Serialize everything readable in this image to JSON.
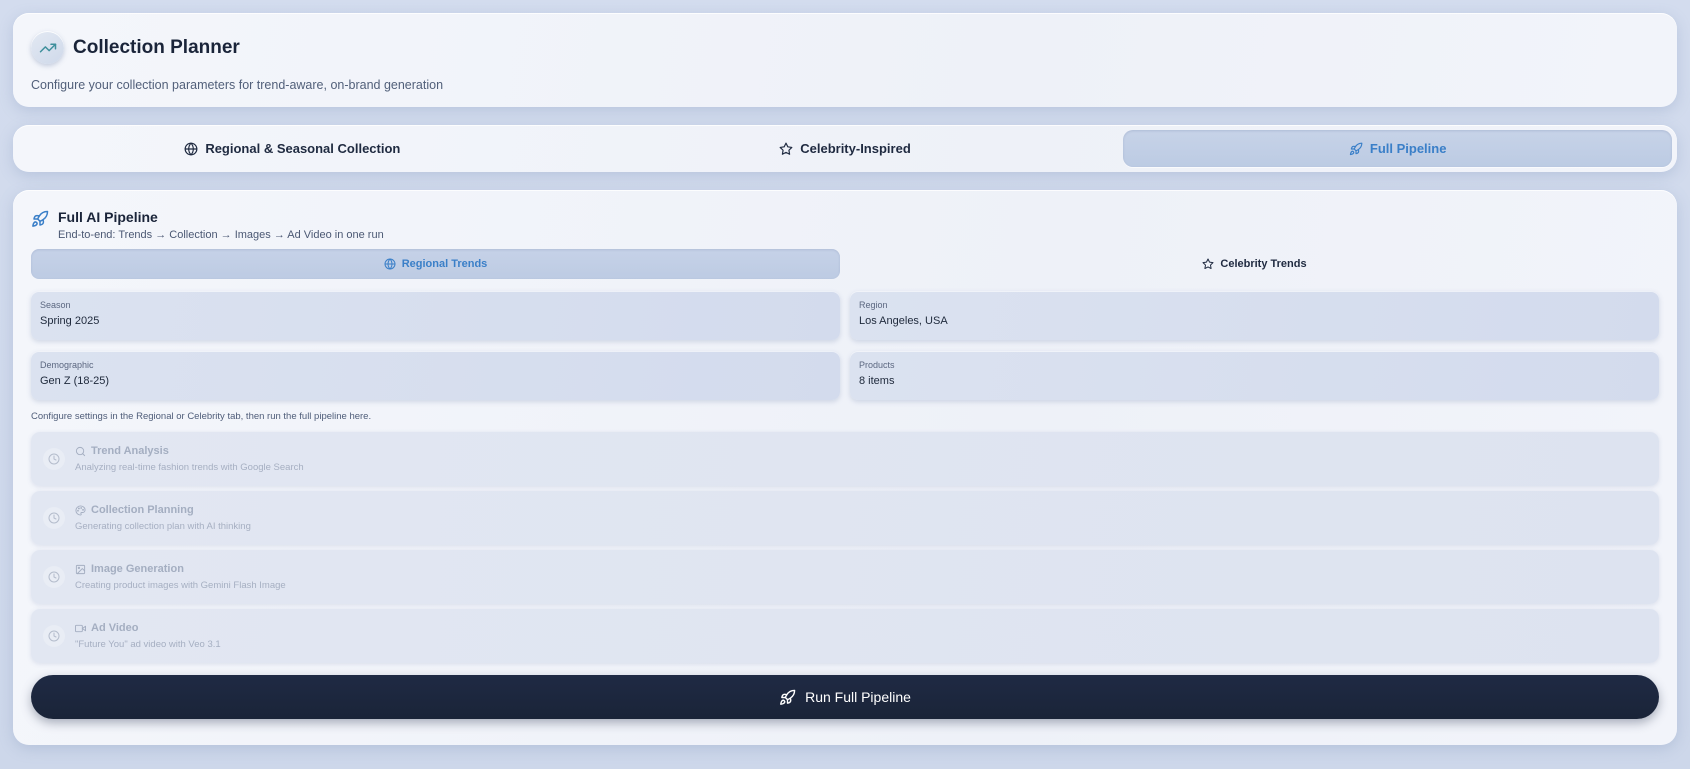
{
  "header": {
    "title": "Collection Planner",
    "subtitle": "Configure your collection parameters for trend-aware, on-brand generation",
    "icon": "trending-up-icon"
  },
  "mode_tabs": [
    {
      "label": "Regional & Seasonal Collection",
      "icon": "globe-icon",
      "active": false
    },
    {
      "label": "Celebrity-Inspired",
      "icon": "star-icon",
      "active": false
    },
    {
      "label": "Full Pipeline",
      "icon": "rocket-icon",
      "active": true
    }
  ],
  "pipeline": {
    "title": "Full AI Pipeline",
    "description": "End-to-end: Trends → Collection → Images → Ad Video in one run",
    "icon": "rocket-icon",
    "source_tabs": [
      {
        "label": "Regional Trends",
        "icon": "globe-icon",
        "active": true
      },
      {
        "label": "Celebrity Trends",
        "icon": "star-icon",
        "active": false
      }
    ],
    "fields": [
      {
        "label": "Season",
        "value": "Spring 2025"
      },
      {
        "label": "Region",
        "value": "Los Angeles, USA"
      },
      {
        "label": "Demographic",
        "value": "Gen Z (18-25)"
      },
      {
        "label": "Products",
        "value": "8 items"
      }
    ],
    "hint": "Configure settings in the Regional or Celebrity tab, then run the full pipeline here.",
    "steps": [
      {
        "title": "Trend Analysis",
        "description": "Analyzing real-time fashion trends with Google Search",
        "icon": "search-icon",
        "status_icon": "clock-icon"
      },
      {
        "title": "Collection Planning",
        "description": "Generating collection plan with AI thinking",
        "icon": "palette-icon",
        "status_icon": "clock-icon"
      },
      {
        "title": "Image Generation",
        "description": "Creating product images with Gemini Flash Image",
        "icon": "image-icon",
        "status_icon": "clock-icon"
      },
      {
        "title": "Ad Video",
        "description": "\"Future You\" ad video with Veo 3.1",
        "icon": "video-icon",
        "status_icon": "clock-icon"
      }
    ],
    "run_button_label": "Run Full Pipeline"
  },
  "colors": {
    "accent": "#3a7fc8",
    "button_dark": "#1f2a44",
    "background": "#ccd6e9"
  }
}
